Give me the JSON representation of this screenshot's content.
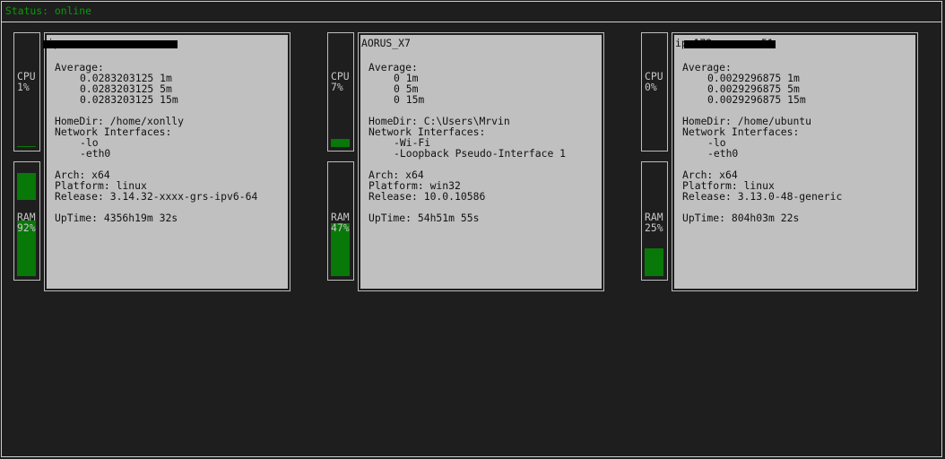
{
  "status": {
    "text": "Status: online"
  },
  "hosts": [
    {
      "hostname": "ip-... .. .. ..u",
      "cpu": {
        "label": "CPU",
        "value": "1%",
        "level": 0.01
      },
      "ram": {
        "label": "RAM",
        "value": "92%",
        "level": 0.92
      },
      "average_label": "Average:",
      "load": [
        "0.0283203125 1m",
        "0.0283203125 5m",
        "0.0283203125 15m"
      ],
      "homedir": "HomeDir: /home/xonlly",
      "net_label": "Network Interfaces:",
      "interfaces": [
        "-lo",
        "-eth0"
      ],
      "arch": "Arch: x64",
      "platform": "Platform: linux",
      "release": "Release: 3.14.32-xxxx-grs-ipv6-64",
      "uptime": "UpTime: 4356h19m 32s"
    },
    {
      "hostname": "AORUS_X7",
      "cpu": {
        "label": "CPU",
        "value": "7%",
        "level": 0.07
      },
      "ram": {
        "label": "RAM",
        "value": "47%",
        "level": 0.47
      },
      "average_label": "Average:",
      "load": [
        "0 1m",
        "0 5m",
        "0 15m"
      ],
      "homedir": "HomeDir: C:\\Users\\Mrvin",
      "net_label": "Network Interfaces:",
      "interfaces": [
        "-Wi-Fi",
        "-Loopback Pseudo-Interface 1"
      ],
      "arch": "Arch: x64",
      "platform": "Platform: win32",
      "release": "Release: 10.0.10586",
      "uptime": "UpTime: 54h51m 55s"
    },
    {
      "hostname": "ip-172-.. .. .51",
      "cpu": {
        "label": "CPU",
        "value": "0%",
        "level": 0.0
      },
      "ram": {
        "label": "RAM",
        "value": "25%",
        "level": 0.25
      },
      "average_label": "Average:",
      "load": [
        "0.0029296875 1m",
        "0.0029296875 5m",
        "0.0029296875 15m"
      ],
      "homedir": "HomeDir: /home/ubuntu",
      "net_label": "Network Interfaces:",
      "interfaces": [
        "-lo",
        "-eth0"
      ],
      "arch": "Arch: x64",
      "platform": "Platform: linux",
      "release": "Release: 3.13.0-48-generic",
      "uptime": "UpTime: 804h03m 22s"
    }
  ]
}
